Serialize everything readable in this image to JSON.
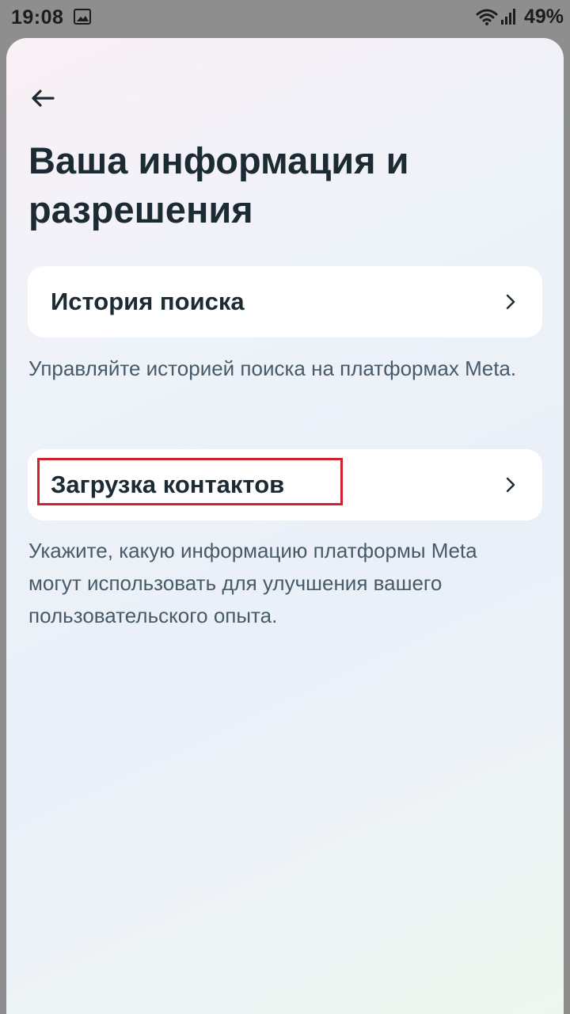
{
  "status_bar": {
    "time": "19:08",
    "battery": "49%",
    "icons": [
      "image-icon",
      "wifi-icon",
      "signal-icon"
    ]
  },
  "header": {
    "back_icon": "arrow-left-icon",
    "title": "Ваша информация и разрешения"
  },
  "items": [
    {
      "label": "История поиска",
      "description": "Управляйте историей поиска на платформах Meta.",
      "icon": "chevron-right-icon"
    },
    {
      "label": "Загрузка контактов",
      "description": "Укажите, какую информацию платформы Meta могут использовать для улучшения вашего пользовательского опыта.",
      "icon": "chevron-right-icon",
      "highlighted": true
    }
  ],
  "colors": {
    "title": "#1c2b33",
    "description": "#465a69",
    "highlight": "#d32030",
    "card": "#ffffff"
  }
}
